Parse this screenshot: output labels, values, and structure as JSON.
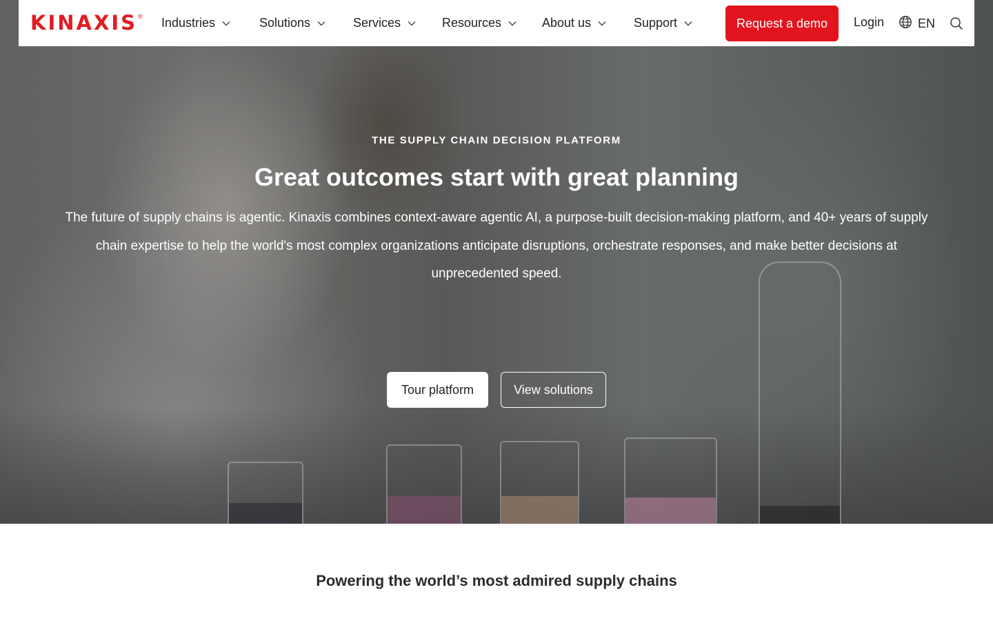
{
  "brand": {
    "name": "KINAXIS",
    "reg": "®",
    "color": "#e31b23"
  },
  "nav": {
    "items": [
      {
        "label": "Industries"
      },
      {
        "label": "Solutions"
      },
      {
        "label": "Services"
      },
      {
        "label": "Resources"
      },
      {
        "label": "About us"
      },
      {
        "label": "Support"
      }
    ],
    "demo_label": "Request a demo",
    "login_label": "Login",
    "language": "EN",
    "icons": [
      "chevron-down-icon",
      "globe-icon",
      "search-icon"
    ]
  },
  "hero": {
    "eyebrow": "THE SUPPLY CHAIN DECISION PLATFORM",
    "headline": "Great outcomes start with great planning",
    "body": "The future of supply chains is agentic. Kinaxis combines context-aware agentic AI, a purpose-built decision-making platform, and 40+ years of supply chain expertise to help the world's most complex organizations anticipate disruptions, orchestrate responses, and make better decisions at unprecedented speed.",
    "primary_cta": "Tour platform",
    "secondary_cta": "View solutions"
  },
  "section": {
    "title": "Powering the world’s most admired supply chains"
  },
  "colors": {
    "accent": "#e2151f",
    "text": "#222222",
    "hero_text": "#ffffff"
  }
}
